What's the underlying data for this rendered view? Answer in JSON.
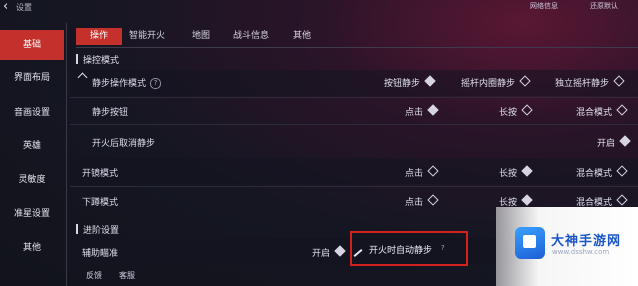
{
  "topbar": {
    "back_label": "设置",
    "buttons": [
      "网络信息",
      "还原默认"
    ]
  },
  "sidebar": {
    "items": [
      {
        "label": "基础",
        "active": true
      },
      {
        "label": "界面布局"
      },
      {
        "label": "音画设置"
      },
      {
        "label": "英雄"
      },
      {
        "label": "灵敏度"
      },
      {
        "label": "准星设置"
      },
      {
        "label": "其他"
      }
    ]
  },
  "tabs": [
    {
      "label": "操作",
      "active": true
    },
    {
      "label": "智能开火"
    },
    {
      "label": "地图"
    },
    {
      "label": "战斗信息"
    },
    {
      "label": "其他"
    }
  ],
  "sections": {
    "control_mode": "操控模式",
    "advanced": "进阶设置"
  },
  "rows": {
    "walk_mode": {
      "label": "静步操作模式",
      "help": "?",
      "options": [
        "按钮静步",
        "摇杆内圈静步",
        "独立摇杆静步"
      ]
    },
    "walk_button": {
      "label": "静步按钮",
      "options": [
        "点击",
        "长按",
        "混合模式"
      ]
    },
    "cancel_walk_on_fire": {
      "label": "开火后取消静步",
      "value": "开启"
    },
    "scope_mode": {
      "label": "开镜模式",
      "options": [
        "点击",
        "长按",
        "混合模式"
      ]
    },
    "crouch_mode": {
      "label": "下蹲模式",
      "options": [
        "点击",
        "长按",
        "混合模式"
      ]
    },
    "aim_assist": {
      "label": "辅助瞄准",
      "value": "开启"
    },
    "auto_walk_on_fire": {
      "label": "开火时自动静步",
      "help": "?"
    }
  },
  "bottom": [
    "反馈",
    "客服"
  ],
  "watermark": {
    "title": "大神手游网",
    "subtitle": "www.dsshw.com"
  },
  "colors": {
    "accent": "#c4302b",
    "highlight_border": "#d52020",
    "watermark_blue": "#1a56c8"
  }
}
